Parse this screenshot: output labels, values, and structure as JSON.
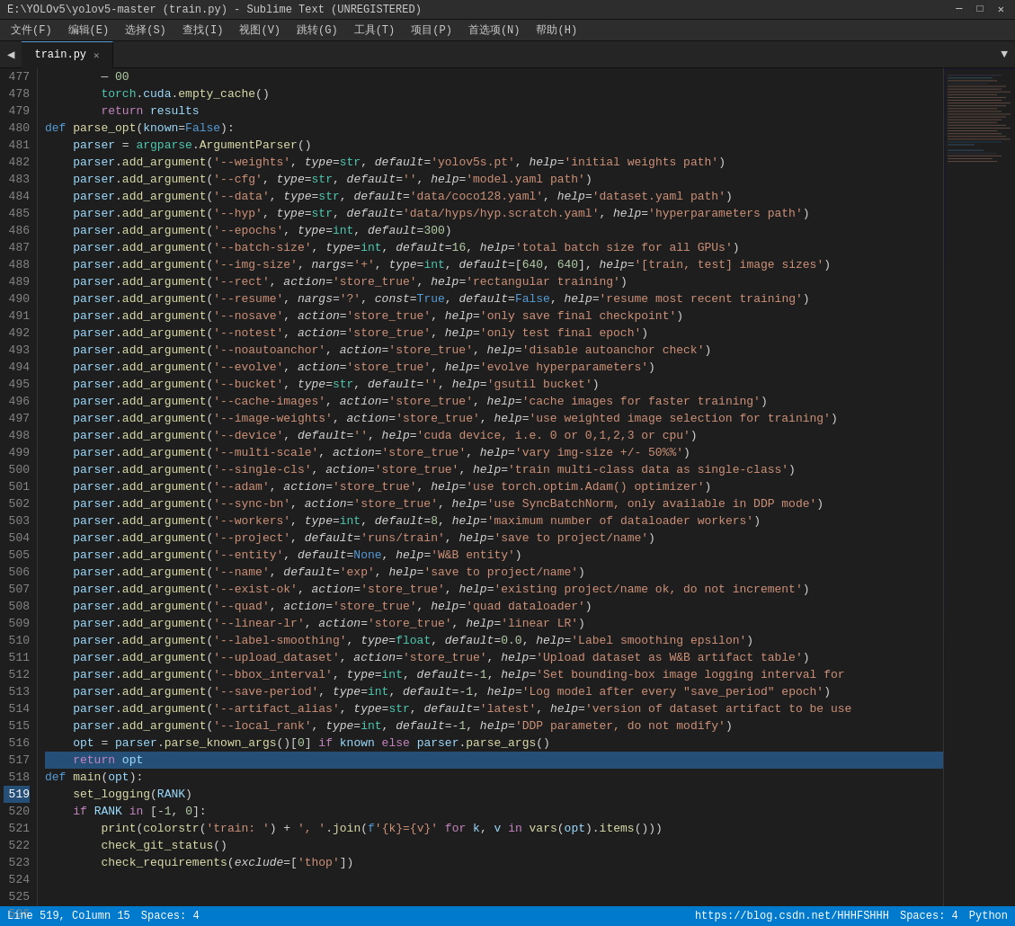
{
  "titleBar": {
    "title": "E:\\YOLOv5\\yolov5-master (train.py) - Sublime Text (UNREGISTERED)",
    "controls": [
      "—",
      "□",
      "✕"
    ]
  },
  "menuBar": {
    "items": [
      "文件(F)",
      "编辑(E)",
      "选择(S)",
      "查找(I)",
      "视图(V)",
      "跳转(G)",
      "工具(T)",
      "项目(P)",
      "首选项(N)",
      "帮助(H)"
    ]
  },
  "tab": {
    "label": "train.py",
    "active": true
  },
  "statusBar": {
    "left": "Line 519, Column 15",
    "spacer": "Spaces: 4",
    "encoding": "Python",
    "url": "https://blog.csdn.net/HHHFSH HHH"
  },
  "lines": {
    "start": 477,
    "highlighted": 519
  }
}
